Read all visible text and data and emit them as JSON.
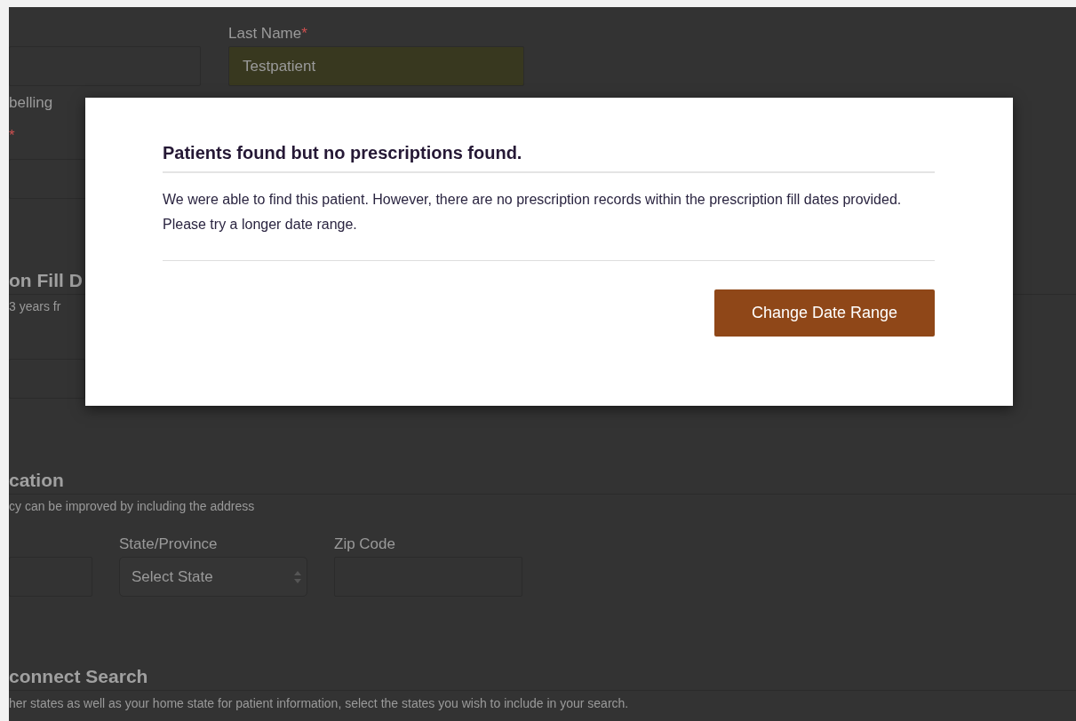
{
  "background_form": {
    "last_name": {
      "label": "Last Name",
      "required_mark": "*",
      "value": "Testpatient",
      "autofilled": true
    },
    "spelling_option": "belling",
    "second_required_mark": "*",
    "date_section": {
      "title": "on Fill D",
      "note": "3 years fr"
    },
    "location_section": {
      "title": "cation",
      "note": "cy can be improved by including the address",
      "state": {
        "label": "State/Province",
        "placeholder": "Select State"
      },
      "zip": {
        "label": "Zip Code"
      }
    },
    "connect_section": {
      "title": "connect Search",
      "note": "her states as well as your home state for patient information, select the states you wish to include in your search."
    }
  },
  "modal": {
    "title": "Patients found but no prescriptions found.",
    "message": "We were able to find this patient. However, there are no prescription records within the prescription fill dates provided. Please try a longer date range.",
    "button": "Change Date Range"
  }
}
